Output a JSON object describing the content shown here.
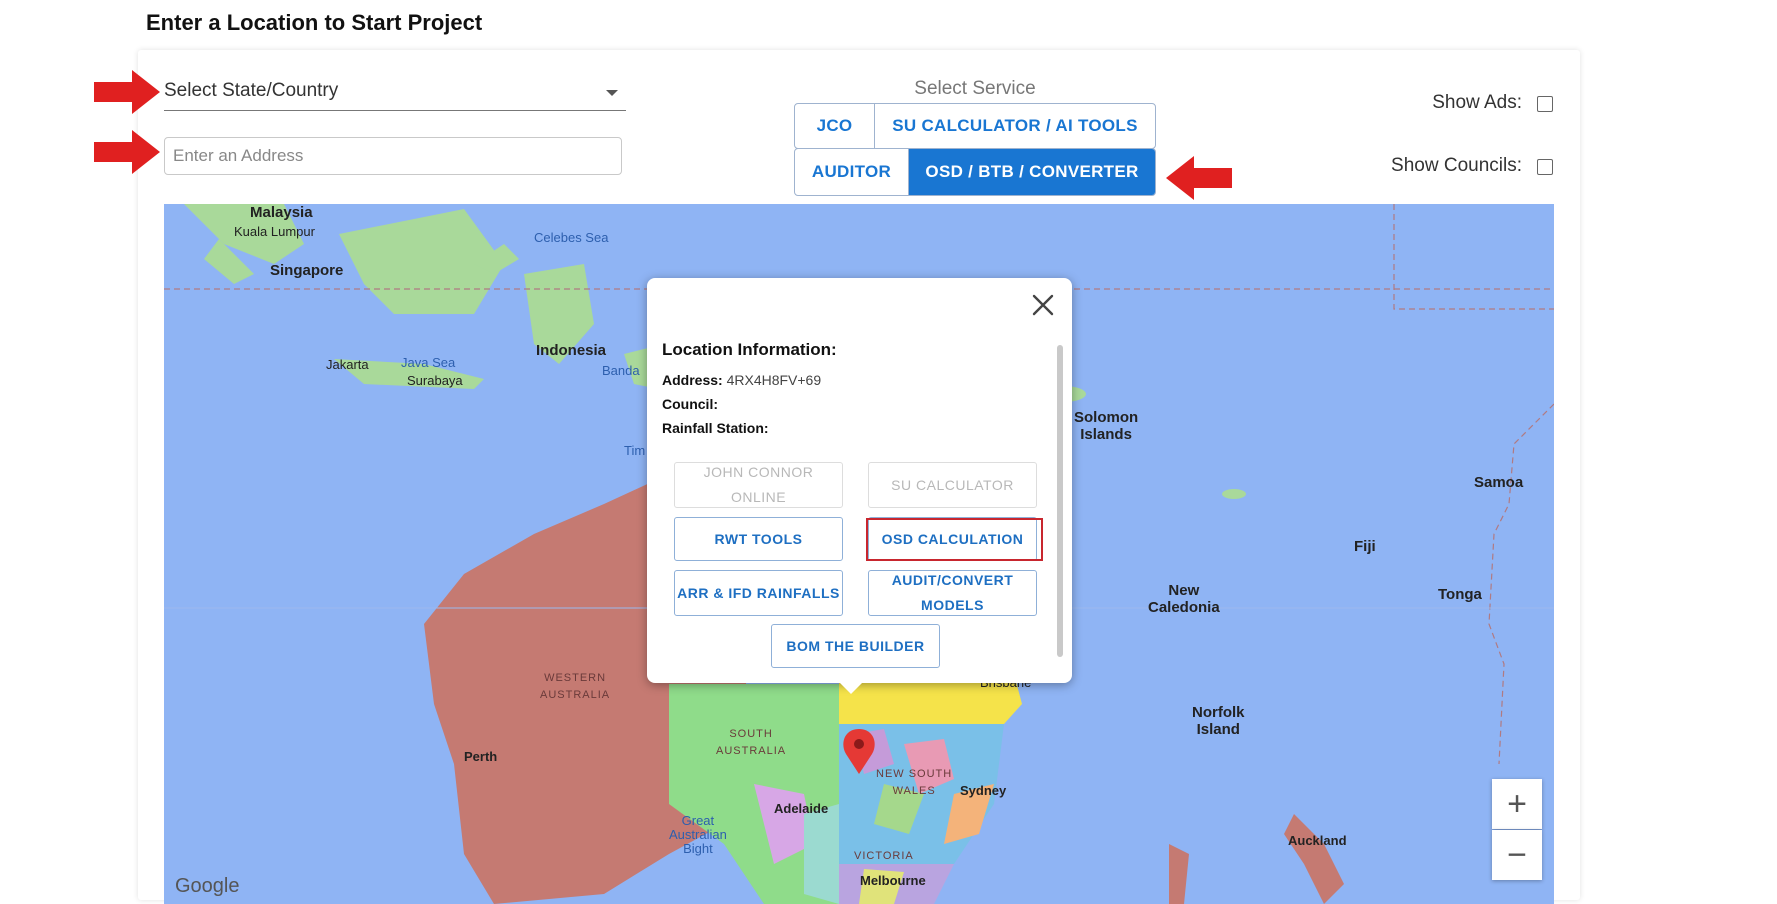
{
  "page": {
    "title": "Enter a Location to Start Project"
  },
  "form": {
    "state_select": {
      "value": "Select State/Country"
    },
    "address": {
      "placeholder": "Enter an Address"
    }
  },
  "service": {
    "label": "Select Service",
    "row1": [
      "JCO",
      "SU CALCULATOR / AI TOOLS"
    ],
    "row2": [
      "AUDITOR",
      "OSD / BTB / CONVERTER"
    ],
    "active": "OSD / BTB / CONVERTER"
  },
  "toggles": {
    "show_ads": "Show Ads:",
    "show_councils": "Show Councils:"
  },
  "map": {
    "labels": {
      "malaysia": "Malaysia",
      "kuala_lumpur": "Kuala Lumpur",
      "singapore": "Singapore",
      "celebes_sea": "Celebes Sea",
      "indonesia": "Indonesia",
      "jakarta": "Jakarta",
      "java_sea": "Java Sea",
      "surabaya": "Surabaya",
      "banda": "Banda",
      "timor": "Tim",
      "solomon": "Solomon\nIslands",
      "samoa": "Samoa",
      "fiji": "Fiji",
      "tonga": "Tonga",
      "new_caledonia": "New\nCaledonia",
      "norfolk": "Norfolk\nIsland",
      "auckland": "Auckland",
      "western_australia": "WESTERN\nAUSTRALIA",
      "south_australia": "SOUTH\nAUSTRALIA",
      "perth": "Perth",
      "great_australian_bight": "Great\nAustralian\nBight",
      "adelaide": "Adelaide",
      "victoria": "VICTORIA",
      "melbourne": "Melbourne",
      "new_south_wales": "NEW SOUTH\nWALES",
      "sydney": "Sydney",
      "brisbane": "Brisbane",
      "google": "Google"
    },
    "zoom_in": "+",
    "zoom_out": "−",
    "colors": {
      "ocean": "#8fb4f4",
      "wa": "#c57a72",
      "sa": "#8fdc8a",
      "qld": "#f5e34a",
      "land": "#90cf8a"
    }
  },
  "popup": {
    "heading": "Location Information:",
    "address_label": "Address:",
    "address_value": "4RX4H8FV+69",
    "council_label": "Council:",
    "rainfall_label": "Rainfall Station:",
    "buttons": {
      "jco": "JOHN CONNOR ONLINE",
      "su": "SU CALCULATOR",
      "rwt": "RWT TOOLS",
      "osd": "OSD CALCULATION",
      "arr": "ARR & IFD RAINFALLS",
      "audit": "AUDIT/CONVERT MODELS",
      "bom": "BOM THE BUILDER"
    }
  }
}
